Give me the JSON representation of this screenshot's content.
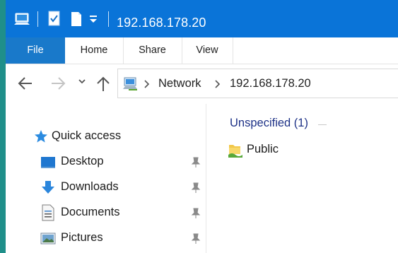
{
  "window": {
    "title": "192.168.178.20",
    "accent": "#0a74d8"
  },
  "quick_access_toolbar": {
    "icons": [
      "computer-icon",
      "properties-icon",
      "new-folder-icon",
      "customize-chevron-icon"
    ]
  },
  "ribbon": {
    "tabs": [
      {
        "label": "File",
        "active": true
      },
      {
        "label": "Home"
      },
      {
        "label": "Share"
      },
      {
        "label": "View"
      }
    ]
  },
  "navigation": {
    "back_icon": "arrow-left-icon",
    "forward_icon": "arrow-right-icon",
    "recent_icon": "chevron-down-icon",
    "up_icon": "arrow-up-icon"
  },
  "address_bar": {
    "breadcrumbs": [
      "Network",
      "192.168.178.20"
    ]
  },
  "nav_pane": {
    "quick_access": "Quick access",
    "items": [
      {
        "label": "Desktop",
        "icon": "desktop-icon",
        "pinned": true
      },
      {
        "label": "Downloads",
        "icon": "download-icon",
        "pinned": true
      },
      {
        "label": "Documents",
        "icon": "document-icon",
        "pinned": true
      },
      {
        "label": "Pictures",
        "icon": "picture-icon",
        "pinned": true
      }
    ]
  },
  "content": {
    "group_header": "Unspecified (1)",
    "items": [
      {
        "label": "Public",
        "icon": "shared-folder-icon"
      }
    ]
  }
}
